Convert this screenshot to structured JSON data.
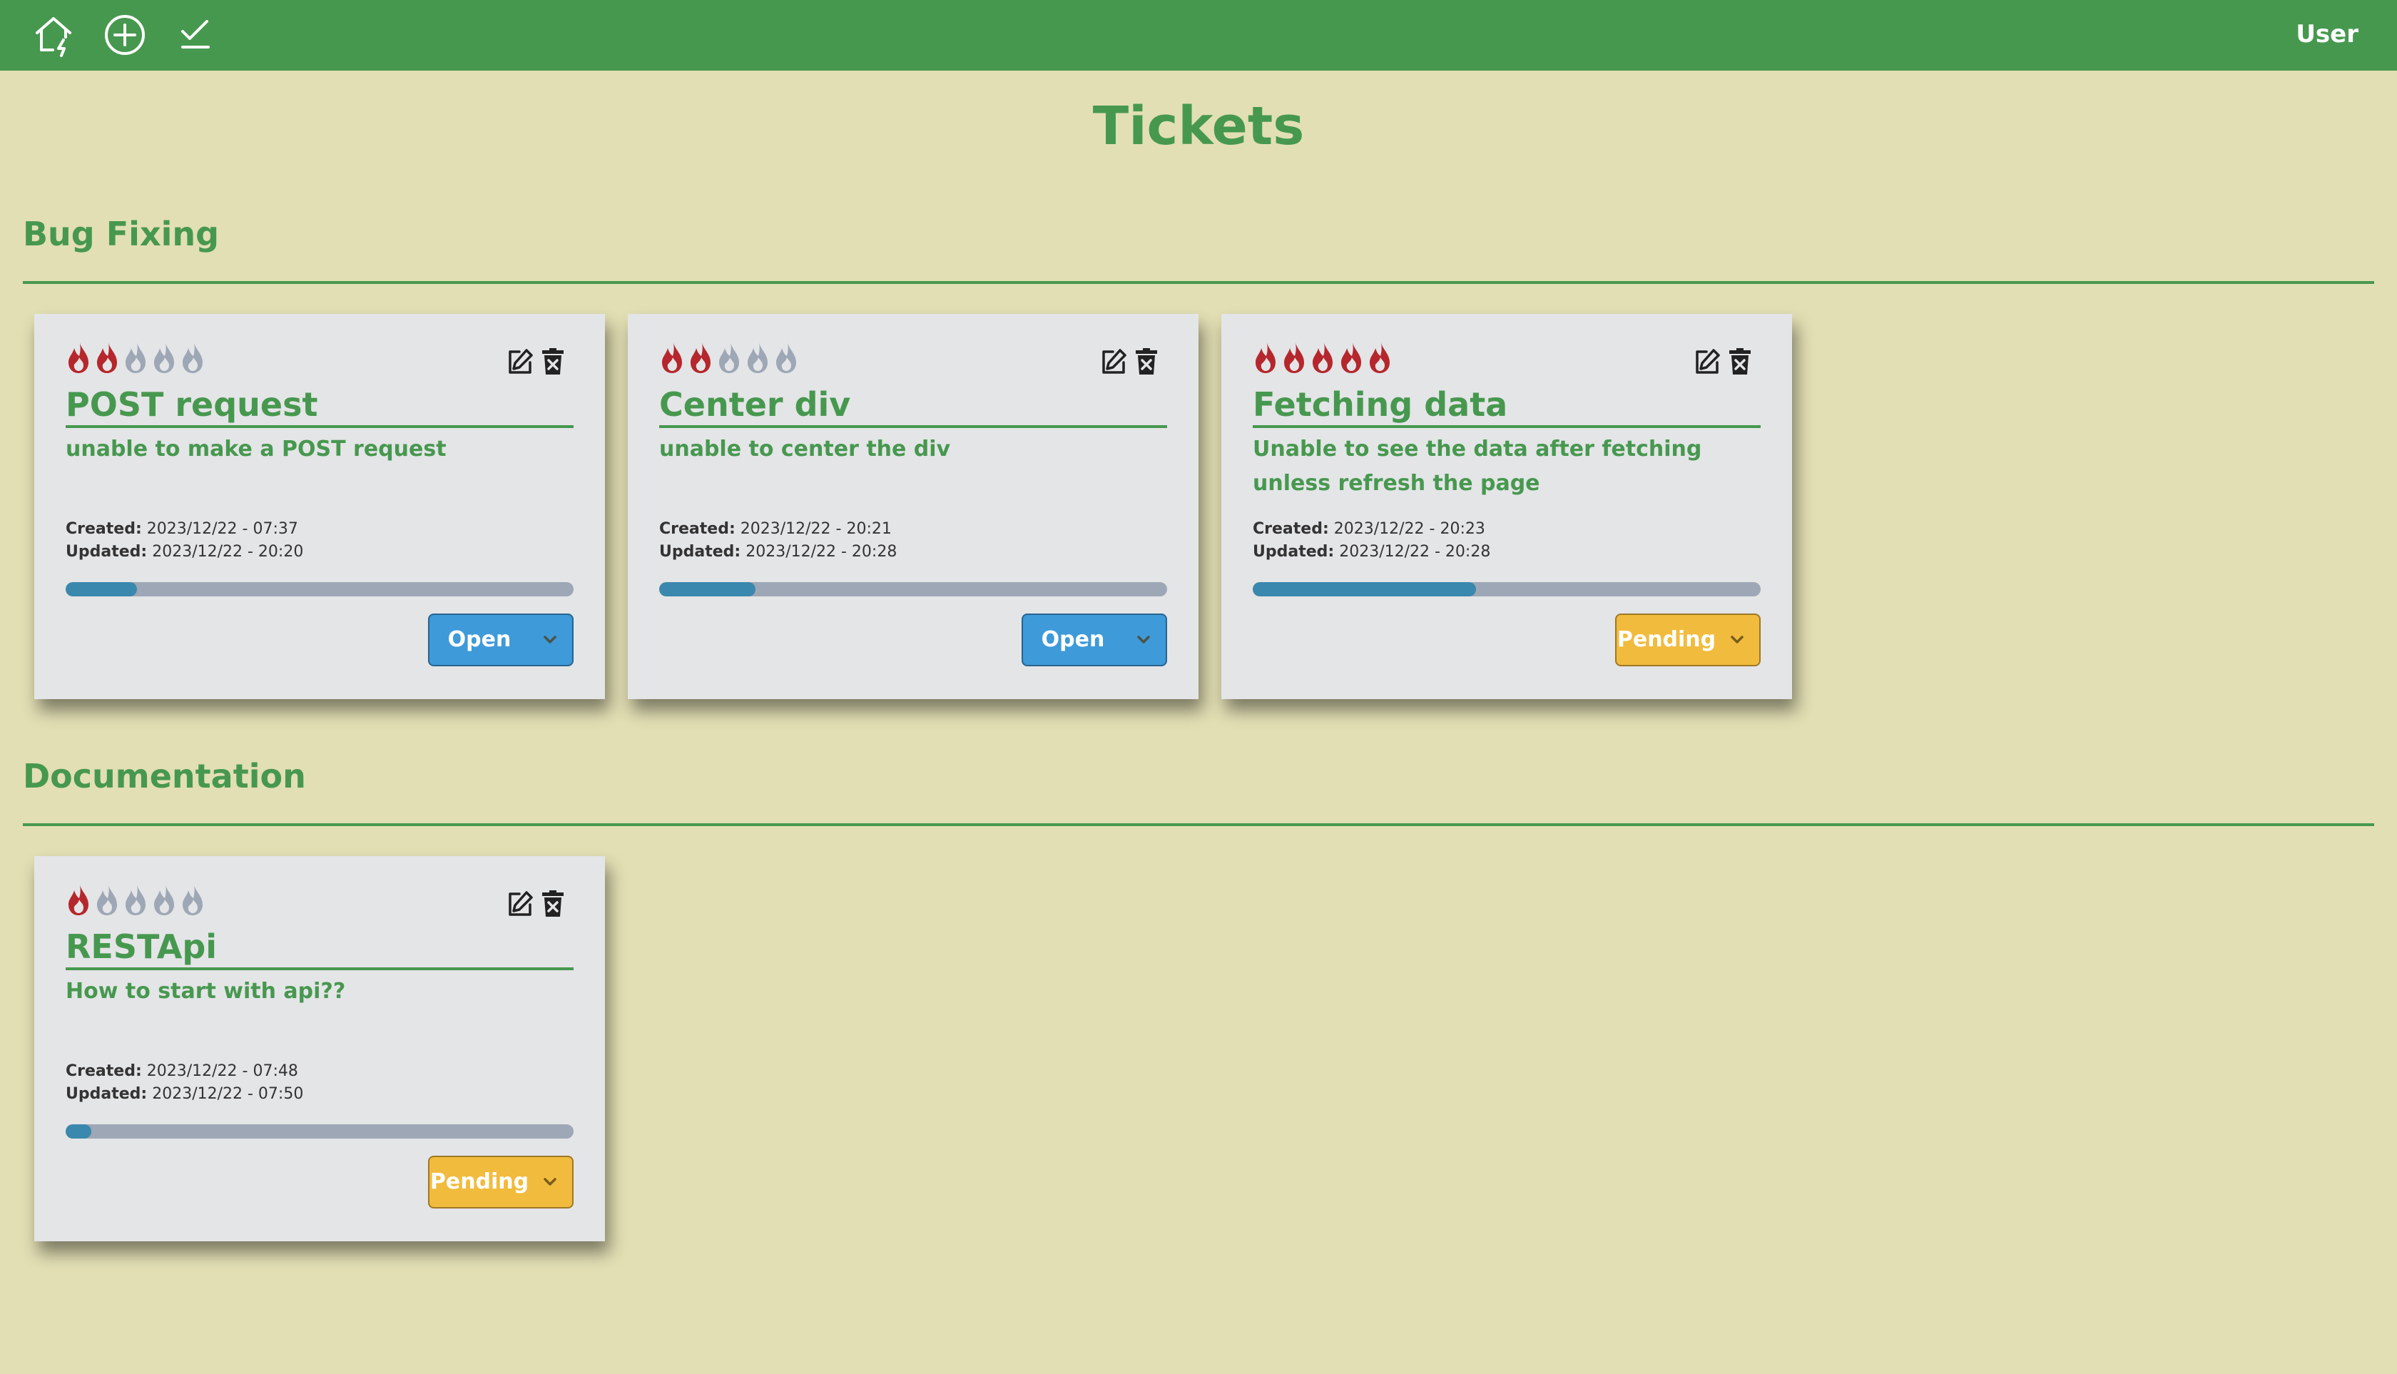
{
  "app": {
    "user_label": "User",
    "page_title": "Tickets",
    "nav": [
      "home-icon",
      "add-ticket-icon",
      "checklist-icon"
    ]
  },
  "colors": {
    "brand": "#47984f",
    "background": "#e2dfb4",
    "card": "#e4e5e7",
    "flame_active": "#b5272c",
    "flame_inactive": "#9ea7b5",
    "progress": "#3a88ad",
    "status_open": "#3e9ad9",
    "status_pending": "#f1bb3d"
  },
  "sections": [
    {
      "title": "Bug Fixing",
      "tickets": [
        {
          "title": "POST request",
          "description": "unable to make a POST request",
          "priority": 2,
          "priority_max": 5,
          "created_label": "Created:",
          "created": "2023/12/22 - 07:37",
          "updated_label": "Updated:",
          "updated": "2023/12/22 - 20:20",
          "progress": 0.14,
          "status": "Open"
        },
        {
          "title": "Center div",
          "description": "unable to center the div",
          "priority": 2,
          "priority_max": 5,
          "created_label": "Created:",
          "created": "2023/12/22 - 20:21",
          "updated_label": "Updated:",
          "updated": "2023/12/22 - 20:28",
          "progress": 0.19,
          "status": "Open"
        },
        {
          "title": "Fetching data",
          "description": "Unable to see the data after fetching unless refresh the page",
          "priority": 5,
          "priority_max": 5,
          "created_label": "Created:",
          "created": "2023/12/22 - 20:23",
          "updated_label": "Updated:",
          "updated": "2023/12/22 - 20:28",
          "progress": 0.44,
          "status": "Pending"
        }
      ]
    },
    {
      "title": "Documentation",
      "tickets": [
        {
          "title": "RESTApi",
          "description": "How to start with api??",
          "priority": 1,
          "priority_max": 5,
          "created_label": "Created:",
          "created": "2023/12/22 - 07:48",
          "updated_label": "Updated:",
          "updated": "2023/12/22 - 07:50",
          "progress": 0.05,
          "status": "Pending"
        }
      ]
    }
  ]
}
